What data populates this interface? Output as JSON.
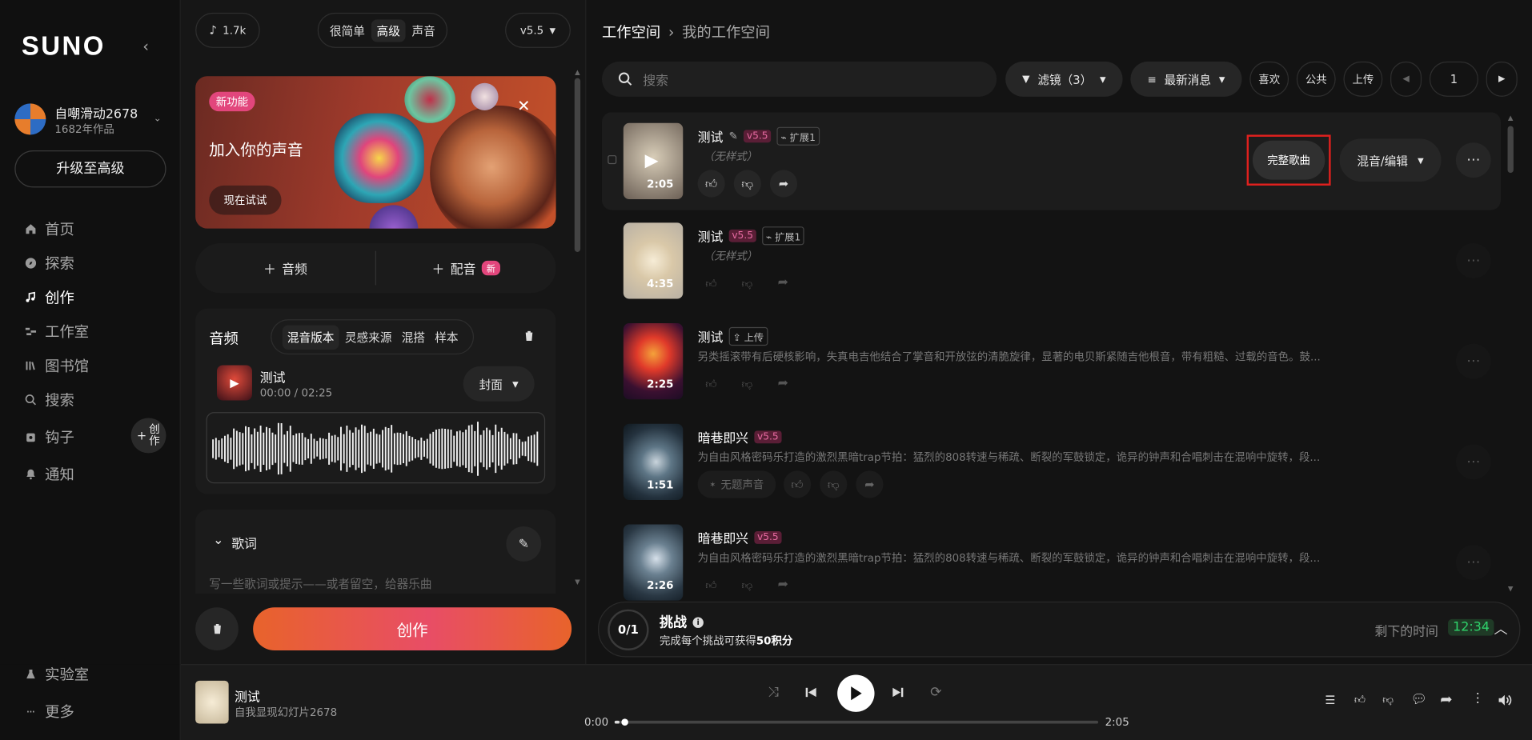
{
  "brand": {
    "logo": "SUNO"
  },
  "user": {
    "name": "自嘲滑动2678",
    "works": "1682年作品"
  },
  "sidebar": {
    "upgrade_label": "升级至高级",
    "items": [
      {
        "label": "首页",
        "icon": "home-icon"
      },
      {
        "label": "探索",
        "icon": "compass-icon"
      },
      {
        "label": "创作",
        "icon": "music-note-icon",
        "active": true
      },
      {
        "label": "工作室",
        "icon": "studio-icon"
      },
      {
        "label": "图书馆",
        "icon": "library-icon"
      },
      {
        "label": "搜索",
        "icon": "search-icon"
      },
      {
        "label": "钩子",
        "icon": "hook-icon"
      },
      {
        "label": "通知",
        "icon": "bell-icon"
      }
    ],
    "create_badge": "创作",
    "bottom": [
      {
        "label": "实验室",
        "icon": "flask-icon"
      },
      {
        "label": "更多",
        "icon": "more-icon"
      }
    ]
  },
  "create": {
    "credits": "1.7k",
    "modes": [
      "很简单",
      "高级",
      "声音"
    ],
    "active_mode": "高级",
    "version": "v5.5",
    "banner": {
      "badge": "新功能",
      "title": "加入你的声音",
      "cta": "现在试试"
    },
    "add_audio": "音频",
    "add_voice": "配音",
    "new_badge": "新",
    "audio": {
      "title": "音频",
      "tabs": [
        "混音版本",
        "灵感来源",
        "混搭",
        "样本"
      ],
      "active_tab": "混音版本",
      "track_title": "测试",
      "track_time": "00:00 / 02:25",
      "cover_label": "封面"
    },
    "lyrics": {
      "title": "歌词",
      "placeholder": "写一些歌词或提示——或者留空，给器乐曲"
    },
    "create_button": "创作"
  },
  "workspace": {
    "breadcrumb_root": "工作空间",
    "breadcrumb_current": "我的工作空间",
    "search_placeholder": "搜索",
    "filter_label": "滤镜（3）",
    "sort_label": "最新消息",
    "chips": [
      "喜欢",
      "公共",
      "上传"
    ],
    "page": "1",
    "full_song_label": "完整歌曲",
    "remix_label": "混音/编辑",
    "songs": [
      {
        "title": "测试",
        "version": "v5.5",
        "tag": "扩展1",
        "style": "（无样式）",
        "duration": "2:05"
      },
      {
        "title": "测试",
        "version": "v5.5",
        "tag": "扩展1",
        "style": "（无样式）",
        "duration": "4:35"
      },
      {
        "title": "测试",
        "tag": "上传",
        "desc": "另类摇滚带有后硬核影响，失真电吉他结合了掌音和开放弦的清脆旋律，显著的电贝斯紧随吉他根音，带有粗糙、过载的音色。鼓...",
        "duration": "2:25"
      },
      {
        "title": "暗巷即兴",
        "version": "v5.5",
        "desc": "为自由风格密码乐打造的激烈黑暗trap节拍：猛烈的808转速与稀疏、断裂的军鼓锁定，诡异的钟声和合唱刺击在混响中旋转，段...",
        "duration": "1:51",
        "extra": "无题声音"
      },
      {
        "title": "暗巷即兴",
        "version": "v5.5",
        "desc": "为自由风格密码乐打造的激烈黑暗trap节拍：猛烈的808转速与稀疏、断裂的军鼓锁定，诡异的钟声和合唱刺击在混响中旋转，段...",
        "duration": "2:26"
      }
    ],
    "challenge": {
      "count": "0/1",
      "title": "挑战",
      "subtitle_prefix": "完成每个挑战可获得",
      "subtitle_points": "50积分",
      "time_label": "剩下的时间",
      "time": "12:34"
    }
  },
  "player": {
    "title": "测试",
    "artist": "自我显现幻灯片2678",
    "current": "0:00",
    "total": "2:05",
    "progress": 0.01
  },
  "colors": {
    "accent_pink": "#e2467c",
    "accent_orange": "#e8632b",
    "timer_green": "#2fd36b",
    "highlight_red": "#e0201e"
  }
}
